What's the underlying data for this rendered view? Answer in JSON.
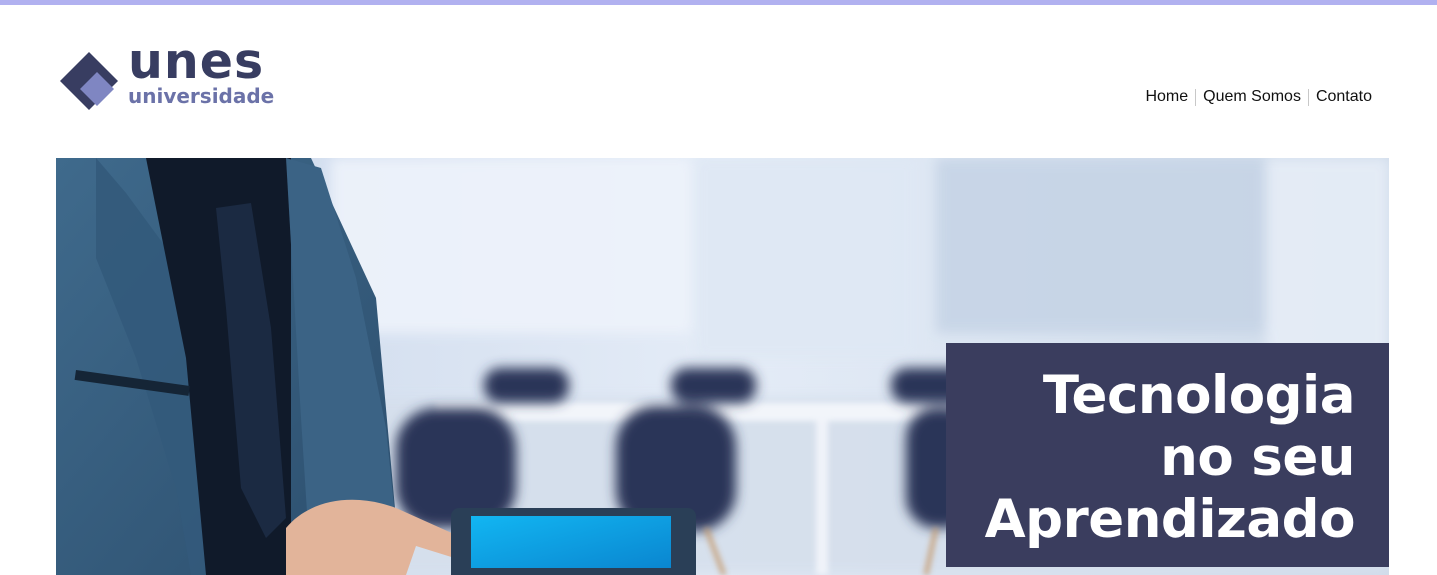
{
  "brand": {
    "name": "unes",
    "tagline": "universidade"
  },
  "nav": {
    "items": [
      {
        "label": "Home"
      },
      {
        "label": "Quem Somos"
      },
      {
        "label": "Contato"
      }
    ]
  },
  "banner": {
    "headline": {
      "line1": "Tecnologia",
      "line2": "no seu",
      "line3": "Aprendizado"
    }
  },
  "colors": {
    "top_bar": "#b1b1f0",
    "brand_dark": "#383d61",
    "brand_light": "#6b72a8",
    "banner_box": "#3a3d5e"
  }
}
